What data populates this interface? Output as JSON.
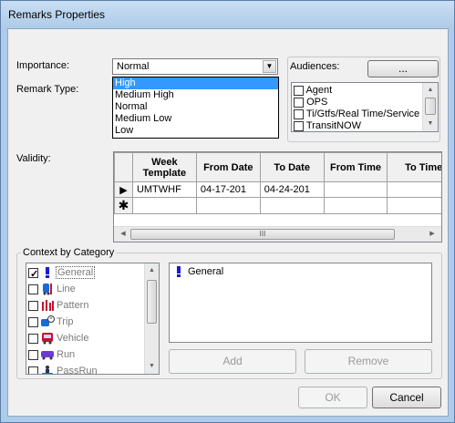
{
  "window": {
    "title": "Remarks Properties"
  },
  "importance": {
    "label": "Importance:",
    "value": "Normal",
    "options": [
      "High",
      "Medium High",
      "Normal",
      "Medium Low",
      "Low"
    ],
    "highlighted": "High"
  },
  "remark_type": {
    "label": "Remark Type:"
  },
  "audiences": {
    "label": "Audiences:",
    "button_label": "...",
    "items": [
      {
        "label": "Agent",
        "checked": false
      },
      {
        "label": "OPS",
        "checked": false
      },
      {
        "label": "Ti/Gtfs/Real Time/Service",
        "checked": false
      },
      {
        "label": "TransitNOW",
        "checked": false
      }
    ]
  },
  "validity": {
    "label": "Validity:",
    "columns": [
      "Week Template",
      "From Date",
      "To Date",
      "From Time",
      "To Time"
    ],
    "rows": [
      {
        "marker": "current",
        "cells": [
          "UMTWHF",
          "04-17-201",
          "04-24-201",
          "",
          ""
        ]
      },
      {
        "marker": "new",
        "cells": [
          "",
          "",
          "",
          "",
          ""
        ]
      }
    ],
    "hscroll_grip": "III"
  },
  "context": {
    "label": "Context by Category",
    "categories": [
      {
        "label": "General",
        "checked": true,
        "icon": "exclamation-icon"
      },
      {
        "label": "Line",
        "checked": false,
        "icon": "line-icon"
      },
      {
        "label": "Pattern",
        "checked": false,
        "icon": "pattern-icon"
      },
      {
        "label": "Trip",
        "checked": false,
        "icon": "trip-icon"
      },
      {
        "label": "Vehicle",
        "checked": false,
        "icon": "vehicle-icon"
      },
      {
        "label": "Run",
        "checked": false,
        "icon": "run-icon"
      },
      {
        "label": "PassRun",
        "checked": false,
        "icon": "passrun-icon"
      }
    ],
    "selected_items": [
      {
        "label": "General",
        "icon": "exclamation-icon"
      }
    ],
    "add_label": "Add",
    "remove_label": "Remove"
  },
  "footer": {
    "ok_label": "OK",
    "cancel_label": "Cancel"
  },
  "colors": {
    "accent": "#3399ff",
    "icon_blue": "#1a1ad4",
    "icon_red": "#c8102e",
    "title_bar": "#aecbe8"
  }
}
